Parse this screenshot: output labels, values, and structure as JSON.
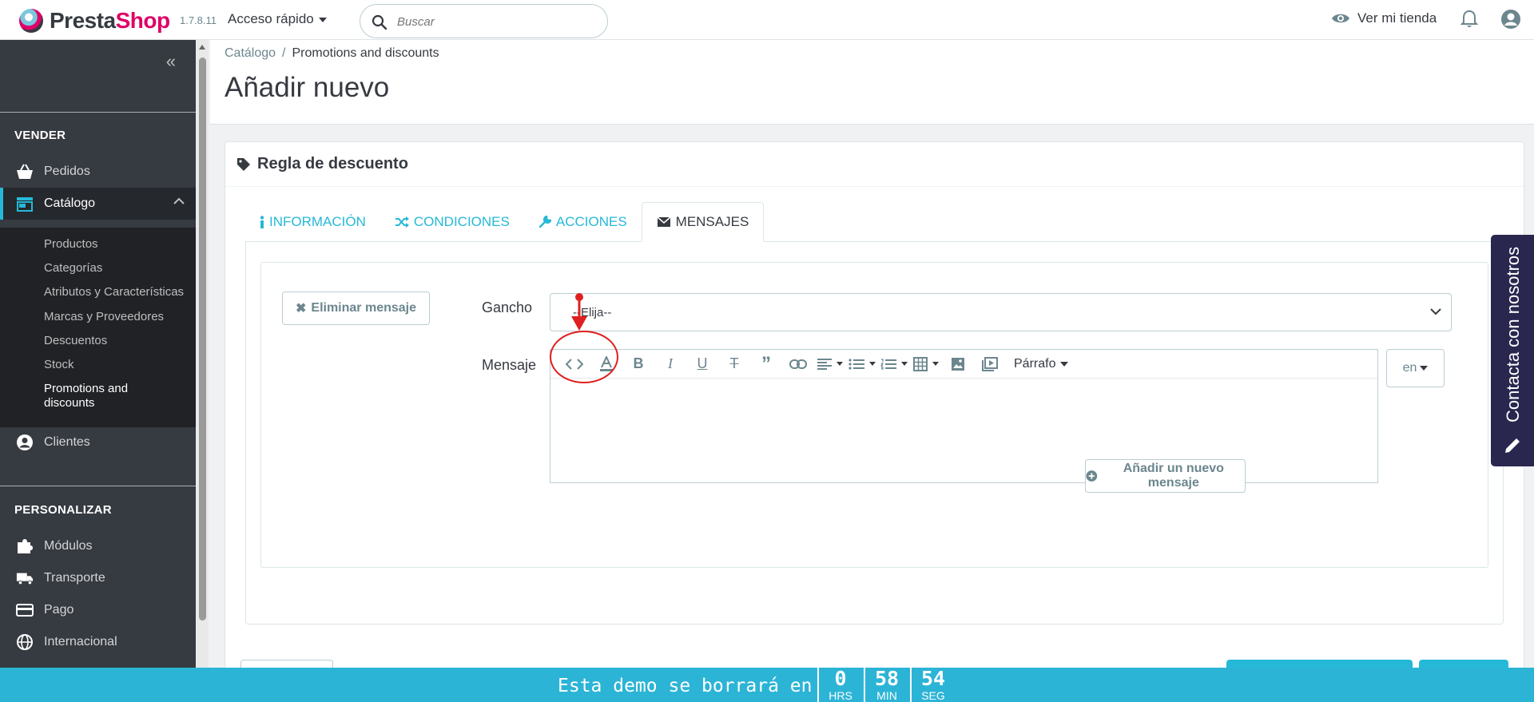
{
  "brand": {
    "name_a": "Presta",
    "name_b": "Shop",
    "version": "1.7.8.11"
  },
  "header": {
    "quick_access": "Acceso rápido",
    "search_placeholder": "Buscar",
    "view_shop": "Ver mi tienda"
  },
  "sidebar": {
    "section_sell": "VENDER",
    "section_customize": "PERSONALIZAR",
    "items": {
      "orders": "Pedidos",
      "catalog": "Catálogo",
      "customers": "Clientes",
      "modules": "Módulos",
      "shipping": "Transporte",
      "payment": "Pago",
      "international": "Internacional"
    },
    "catalog_sub": [
      "Productos",
      "Categorías",
      "Atributos y Características",
      "Marcas y Proveedores",
      "Descuentos",
      "Stock",
      "Promotions and discounts"
    ]
  },
  "breadcrumb": {
    "parent": "Catálogo",
    "separator": "/",
    "current": "Promotions and discounts"
  },
  "page_title": "Añadir nuevo",
  "panel": {
    "title": "Regla de descuento",
    "tabs": [
      "INFORMACIÓN",
      "CONDICIONES",
      "ACCIONES",
      "MENSAJES"
    ],
    "active_tab": "MENSAJES",
    "delete_message": "Eliminar mensaje",
    "hook_label": "Gancho",
    "hook_value": "--Elija--",
    "message_label": "Mensaje",
    "format_dropdown": "Párrafo",
    "language": "en",
    "add_message": "Añadir un nuevo mensaje"
  },
  "contact_tab": "Contacta con nosotros",
  "demo_bar": {
    "message": "Esta demo se borrará en",
    "hours": "0",
    "hours_unit": "HRS",
    "minutes": "58",
    "minutes_unit": "MIN",
    "seconds": "54",
    "seconds_unit": "SEG"
  },
  "colors": {
    "accent": "#25b9d7",
    "brand_pink": "#df0067",
    "sidebar": "#363a41",
    "annotation": "#e02020",
    "demo_bar": "#2cb4d6"
  }
}
